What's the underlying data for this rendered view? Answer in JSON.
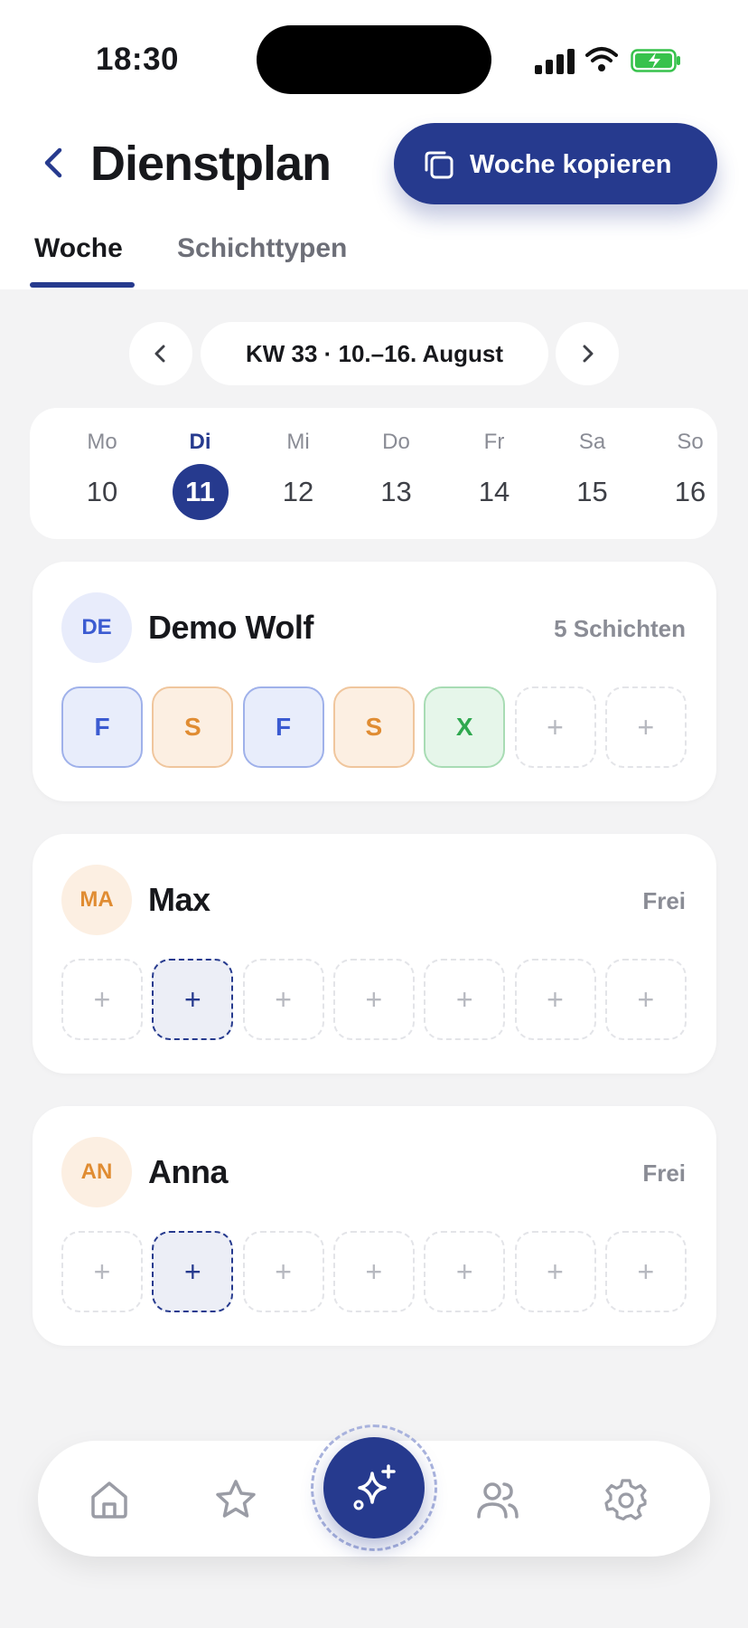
{
  "status_bar": {
    "time": "18:30"
  },
  "header": {
    "title": "Dienstplan",
    "copy_button_label": "Woche kopieren"
  },
  "tabs": [
    {
      "label": "Woche",
      "active": true
    },
    {
      "label": "Schichttypen",
      "active": false
    }
  ],
  "week_nav": {
    "label": "KW 33 · 10.–16. August"
  },
  "days": [
    {
      "name": "Mo",
      "num": "10",
      "active": false
    },
    {
      "name": "Di",
      "num": "11",
      "active": true
    },
    {
      "name": "Mi",
      "num": "12",
      "active": false
    },
    {
      "name": "Do",
      "num": "13",
      "active": false
    },
    {
      "name": "Fr",
      "num": "14",
      "active": false
    },
    {
      "name": "Sa",
      "num": "15",
      "active": false
    },
    {
      "name": "So",
      "num": "16",
      "active": false
    }
  ],
  "employees": [
    {
      "initials": "DE",
      "name": "Demo Wolf",
      "meta": "5 Schichten",
      "avatar_color": "blue",
      "slots": [
        {
          "label": "F",
          "type": "f"
        },
        {
          "label": "S",
          "type": "s"
        },
        {
          "label": "F",
          "type": "f"
        },
        {
          "label": "S",
          "type": "s"
        },
        {
          "label": "X",
          "type": "x"
        },
        {
          "label": "+",
          "type": "empty"
        },
        {
          "label": "+",
          "type": "empty"
        }
      ]
    },
    {
      "initials": "MA",
      "name": "Max",
      "meta": "Frei",
      "avatar_color": "orange",
      "slots": [
        {
          "label": "+",
          "type": "empty"
        },
        {
          "label": "+",
          "type": "sel"
        },
        {
          "label": "+",
          "type": "empty"
        },
        {
          "label": "+",
          "type": "empty"
        },
        {
          "label": "+",
          "type": "empty"
        },
        {
          "label": "+",
          "type": "empty"
        },
        {
          "label": "+",
          "type": "empty"
        }
      ]
    },
    {
      "initials": "AN",
      "name": "Anna",
      "meta": "Frei",
      "avatar_color": "orange",
      "slots": [
        {
          "label": "+",
          "type": "empty"
        },
        {
          "label": "+",
          "type": "sel"
        },
        {
          "label": "+",
          "type": "empty"
        },
        {
          "label": "+",
          "type": "empty"
        },
        {
          "label": "+",
          "type": "empty"
        },
        {
          "label": "+",
          "type": "empty"
        },
        {
          "label": "+",
          "type": "empty"
        }
      ]
    }
  ],
  "bottom_nav": {
    "items": [
      {
        "icon": "home-icon"
      },
      {
        "icon": "star-icon"
      },
      {
        "icon": "sparkles-icon"
      },
      {
        "icon": "users-icon"
      },
      {
        "icon": "gear-icon"
      }
    ]
  },
  "colors": {
    "accent": "#263a8e",
    "background": "#f3f3f4"
  }
}
